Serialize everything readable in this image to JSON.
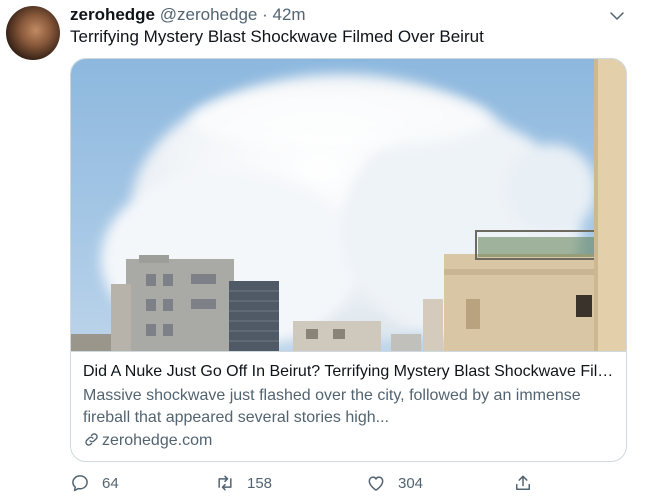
{
  "tweet": {
    "author_name": "zerohedge",
    "handle": "@zerohedge",
    "separator": "·",
    "time": "42m",
    "text": "Terrifying Mystery Blast Shockwave Filmed Over Beirut"
  },
  "card": {
    "title": "Did A Nuke Just Go Off In Beirut? Terrifying Mystery Blast Shockwave Filmed Over Beirut",
    "description": "Massive shockwave just flashed over the city, followed by an immense fireball that appeared several stories high...",
    "domain": "zerohedge.com"
  },
  "actions": {
    "replies": "64",
    "retweets": "158",
    "likes": "304"
  },
  "icons": [
    "chevron-down-icon",
    "link-icon",
    "reply-icon",
    "retweet-icon",
    "like-icon",
    "share-icon"
  ]
}
